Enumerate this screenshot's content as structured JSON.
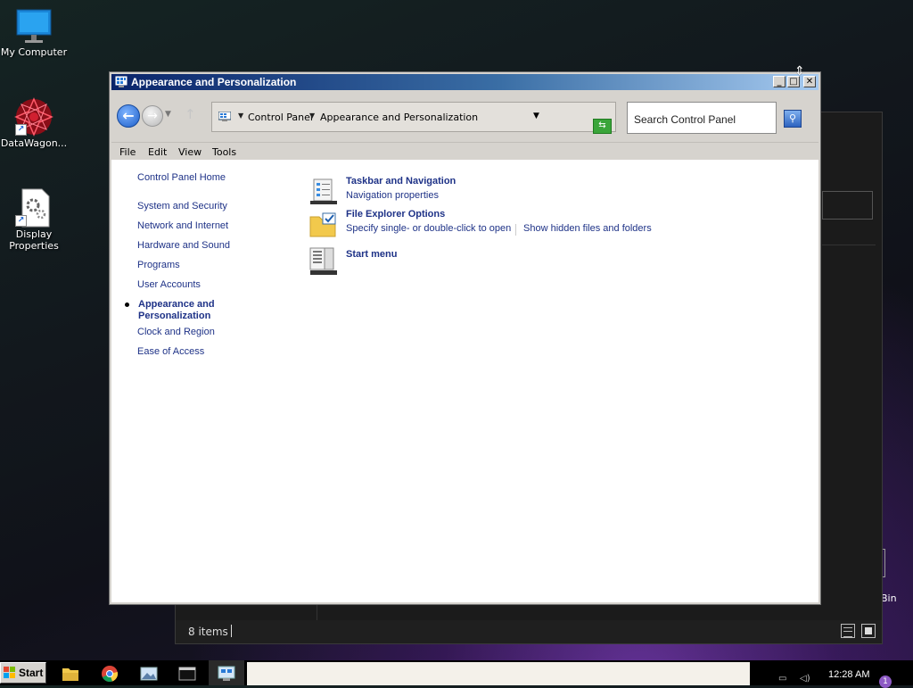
{
  "desktop": {
    "icons": [
      {
        "label": "My Computer",
        "icon": "monitor-icon"
      },
      {
        "label": "DataWagon...",
        "icon": "datawagon-logo-icon"
      },
      {
        "label": "Display Properties",
        "icon": "display-properties-icon"
      }
    ],
    "partial_label": "Bin"
  },
  "background_window": {
    "status_count": "8 items"
  },
  "window": {
    "title": "Appearance and Personalization",
    "controls": {
      "minimize": "_",
      "maximize": "□",
      "close": "✕"
    }
  },
  "navigation": {
    "address": {
      "crumbs": [
        "Control Panel",
        "Appearance and Personalization"
      ]
    },
    "search_placeholder": "Search Control Panel"
  },
  "menu": [
    "File",
    "Edit",
    "View",
    "Tools"
  ],
  "sidebar": {
    "home": "Control Panel Home",
    "items": [
      "System and Security",
      "Network and Internet",
      "Hardware and Sound",
      "Programs",
      "User Accounts"
    ],
    "current_line1": "Appearance and",
    "current_line2": "Personalization",
    "items_after": [
      "Clock and Region",
      "Ease of Access"
    ]
  },
  "categories": [
    {
      "title": "Taskbar and Navigation",
      "links": [
        "Navigation properties"
      ],
      "icon": "taskbar-icon"
    },
    {
      "title": "File Explorer Options",
      "links": [
        "Specify single- or double-click to open",
        "Show hidden files and folders"
      ],
      "icon": "folder-options-icon"
    },
    {
      "title": "Start menu",
      "links": [],
      "icon": "start-menu-icon"
    }
  ],
  "taskbar": {
    "start_label": "Start",
    "apps": [
      "file-explorer-icon",
      "chrome-icon",
      "image-viewer-icon",
      "terminal-icon",
      "control-panel-icon"
    ],
    "clock": "12:28 AM"
  },
  "colors": {
    "link": "#1e3287",
    "titlebar_start": "#0a246a",
    "titlebar_end": "#a6caf0",
    "window_chrome": "#d6d3ce"
  }
}
